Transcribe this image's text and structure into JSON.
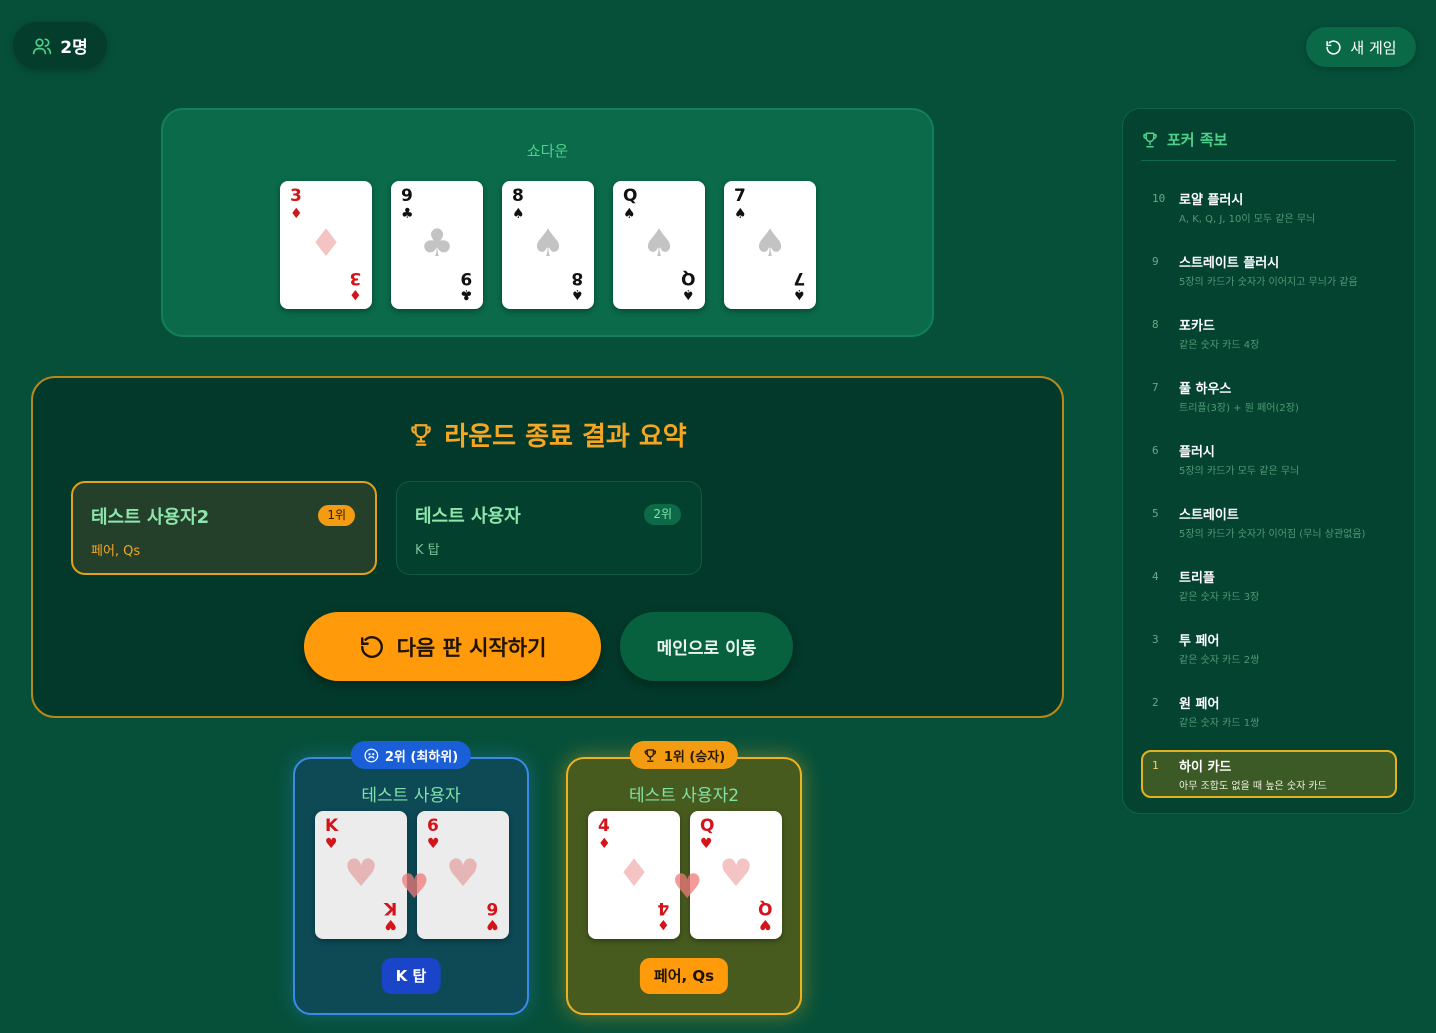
{
  "header": {
    "player_count": "2명",
    "new_game_label": "새 게임"
  },
  "showdown": {
    "title": "쇼다운",
    "cards": [
      {
        "rank": "3",
        "suit": "♦",
        "color": "red"
      },
      {
        "rank": "9",
        "suit": "♣",
        "color": "black"
      },
      {
        "rank": "8",
        "suit": "♠",
        "color": "black"
      },
      {
        "rank": "Q",
        "suit": "♠",
        "color": "black"
      },
      {
        "rank": "7",
        "suit": "♠",
        "color": "black"
      }
    ]
  },
  "summary": {
    "title": "라운드 종료 결과 요약",
    "results": [
      {
        "name": "테스트 사용자2",
        "hand": "페어, Qs",
        "rank": "1위"
      },
      {
        "name": "테스트 사용자",
        "hand": "K 탑",
        "rank": "2위"
      }
    ],
    "next_round_label": "다음 판 시작하기",
    "go_main_label": "메인으로 이동"
  },
  "seats": [
    {
      "tag": "2위 (최하위)",
      "name": "테스트 사용자",
      "cards": [
        {
          "rank": "K",
          "suit": "♥",
          "color": "red"
        },
        {
          "rank": "6",
          "suit": "♥",
          "color": "red"
        }
      ],
      "result": "K 탑"
    },
    {
      "tag": "1위 (승자)",
      "name": "테스트 사용자2",
      "cards": [
        {
          "rank": "4",
          "suit": "♦",
          "color": "red"
        },
        {
          "rank": "Q",
          "suit": "♥",
          "color": "red"
        }
      ],
      "result": "페어, Qs"
    }
  ],
  "rankings": {
    "title": "포커 족보",
    "hands": [
      {
        "num": "10",
        "name": "로얄 플러시",
        "desc": "A, K, Q, J, 10이 모두 같은 무늬"
      },
      {
        "num": "9",
        "name": "스트레이트 플러시",
        "desc": "5장의 카드가 숫자가 이어지고 무늬가 같음"
      },
      {
        "num": "8",
        "name": "포카드",
        "desc": "같은 숫자 카드 4장"
      },
      {
        "num": "7",
        "name": "풀 하우스",
        "desc": "트리플(3장) + 원 페어(2장)"
      },
      {
        "num": "6",
        "name": "플러시",
        "desc": "5장의 카드가 모두 같은 무늬"
      },
      {
        "num": "5",
        "name": "스트레이트",
        "desc": "5장의 카드가 숫자가 이어짐 (무늬 상관없음)"
      },
      {
        "num": "4",
        "name": "트리플",
        "desc": "같은 숫자 카드 3장"
      },
      {
        "num": "3",
        "name": "투 페어",
        "desc": "같은 숫자 카드 2쌍"
      },
      {
        "num": "2",
        "name": "원 페어",
        "desc": "같은 숫자 카드 1쌍"
      },
      {
        "num": "1",
        "name": "하이 카드",
        "desc": "아무 조합도 없을 때 높은 숫자 카드"
      }
    ],
    "active_index": 9
  },
  "colors": {
    "background": "#06503a",
    "accent_orange": "#ff9a0a",
    "accent_green": "#4fd08c",
    "loser_blue": "#3a8be8",
    "winner_gold": "#f0b020"
  }
}
